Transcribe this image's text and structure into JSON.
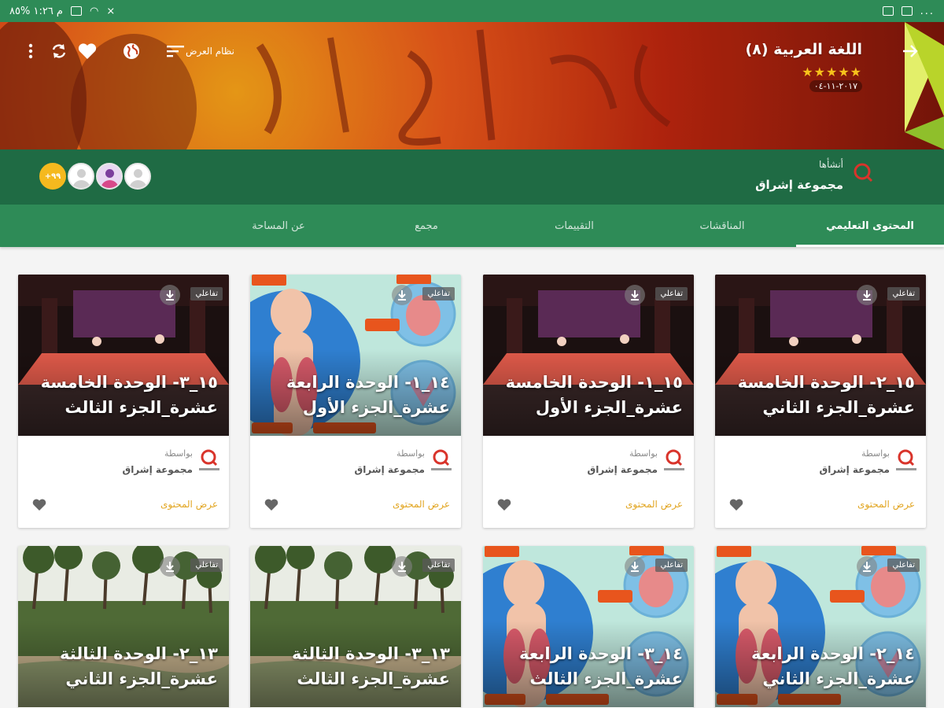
{
  "status_bar": {
    "left_text": "م ١:٢٦  %٨٥",
    "right_text": "..."
  },
  "header": {
    "course_title": "اللغة العربية (٨)",
    "rating_stars": "★★★★★",
    "rating": 5,
    "date": "٢٠١٧-١١-٠٤",
    "sort_label": "نظام العرض",
    "icons": [
      "back-arrow-icon",
      "sort-icon",
      "globe-icon",
      "heart-icon",
      "sync-icon",
      "more-vertical-icon"
    ]
  },
  "author": {
    "created_label": "أنشأها",
    "name": "مجموعة إشراق",
    "member_count": "+٩٩"
  },
  "tabs": [
    {
      "label": "المحتوى التعليمي",
      "active": true
    },
    {
      "label": "المناقشات",
      "active": false
    },
    {
      "label": "التقييمات",
      "active": false
    },
    {
      "label": "مجمع",
      "active": false
    },
    {
      "label": "عن المساحة",
      "active": false
    }
  ],
  "card_common": {
    "badge": "تفاعلي",
    "by_label": "بواسطة",
    "author": "مجموعة إشراق",
    "view_label": "عرض المحتوى"
  },
  "cards_row1": [
    {
      "title": "١٥_٢- الوحدة الخامسة عشرة_الجزء الثاني",
      "image": "theater"
    },
    {
      "title": "١٥_١- الوحدة الخامسة عشرة_الجزء الأول",
      "image": "theater"
    },
    {
      "title": "١٤_١- الوحدة الرابعة عشرة_الجزء الأول",
      "image": "anatomy"
    },
    {
      "title": "١٥_٣- الوحدة الخامسة عشرة_الجزء الثالث",
      "image": "theater"
    }
  ],
  "cards_row2": [
    {
      "title": "١٤_٢- الوحدة الرابعة عشرة_الجزء الثاني",
      "image": "anatomy"
    },
    {
      "title": "١٤_٣- الوحدة الرابعة عشرة_الجزء الثالث",
      "image": "anatomy"
    },
    {
      "title": "١٣_٣- الوحدة الثالثة عشرة_الجزء الثالث",
      "image": "nile"
    },
    {
      "title": "١٣_٢- الوحدة الثالثة عشرة_الجزء الثاني",
      "image": "nile"
    }
  ],
  "colors": {
    "status_bar": "#2e8b57",
    "tab_bar": "#2e8b57",
    "author_strip": "#1f6b44",
    "accent_link": "#e2a623",
    "stars": "#f7c21b",
    "member_count": "#f5b91e"
  }
}
